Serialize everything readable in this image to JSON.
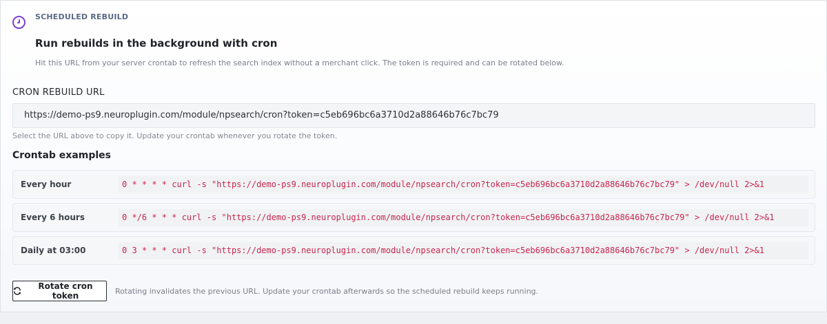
{
  "header": {
    "eyebrow": "SCHEDULED REBUILD",
    "title": "Run rebuilds in the background with cron",
    "description": "Hit this URL from your server crontab to refresh the search index without a merchant click. The token is required and can be rotated below.",
    "icon": "clock-icon",
    "accent_color": "#7b3fd4"
  },
  "cron_url": {
    "label": "CRON REBUILD URL",
    "value": "https://demo-ps9.neuroplugin.com/module/npsearch/cron?token=c5eb696bc6a3710d2a88646b76c7bc79",
    "help": "Select the URL above to copy it. Update your crontab whenever you rotate the token."
  },
  "examples": {
    "title": "Crontab examples",
    "rows": [
      {
        "label": "Every hour",
        "command": "0 * * * * curl -s \"https://demo-ps9.neuroplugin.com/module/npsearch/cron?token=c5eb696bc6a3710d2a88646b76c7bc79\" > /dev/null 2>&1"
      },
      {
        "label": "Every 6 hours",
        "command": "0 */6 * * * curl -s \"https://demo-ps9.neuroplugin.com/module/npsearch/cron?token=c5eb696bc6a3710d2a88646b76c7bc79\" > /dev/null 2>&1"
      },
      {
        "label": "Daily at 03:00",
        "command": "0 3 * * * curl -s \"https://demo-ps9.neuroplugin.com/module/npsearch/cron?token=c5eb696bc6a3710d2a88646b76c7bc79\" > /dev/null 2>&1"
      }
    ],
    "code_color": "#c7254e"
  },
  "rotate": {
    "button_label": "Rotate cron token",
    "icon": "refresh-icon",
    "note": "Rotating invalidates the previous URL. Update your crontab afterwards so the scheduled rebuild keeps running."
  }
}
